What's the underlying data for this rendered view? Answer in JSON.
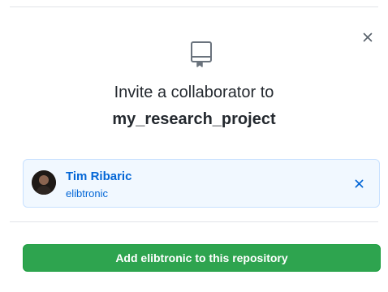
{
  "dialog": {
    "title_prefix": "Invite a collaborator to",
    "repo_name": "my_research_project",
    "close_icon": "close-icon",
    "repo_icon": "repo-icon"
  },
  "selected_user": {
    "name": "Tim Ribaric",
    "login": "elibtronic",
    "avatar_icon": "avatar",
    "remove_icon": "close-icon"
  },
  "actions": {
    "add_label": "Add elibtronic to this repository"
  },
  "colors": {
    "link_blue": "#0366d6",
    "card_bg": "#f1f8ff",
    "card_border": "#c8e1ff",
    "button_green": "#2ea44f",
    "icon_gray": "#6a737d"
  }
}
